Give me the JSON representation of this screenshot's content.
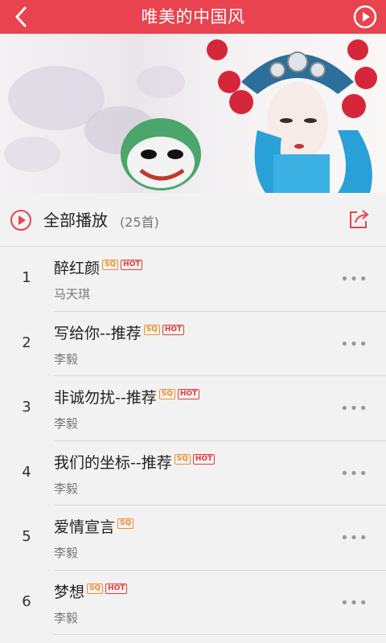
{
  "header": {
    "title": "唯美的中国风"
  },
  "banner": {
    "image": "chinese-opera-woman-with-mask"
  },
  "play_all": {
    "label": "全部播放",
    "count": "(25首)"
  },
  "badges": {
    "sq": "SQ",
    "hot": "HOT"
  },
  "songs": [
    {
      "num": "1",
      "title": "醉红颜",
      "artist": "马天琪",
      "sq": true,
      "hot": true
    },
    {
      "num": "2",
      "title": "写给你--推荐",
      "artist": "李毅",
      "sq": true,
      "hot": true
    },
    {
      "num": "3",
      "title": "非诚勿扰--推荐",
      "artist": "李毅",
      "sq": true,
      "hot": true
    },
    {
      "num": "4",
      "title": "我们的坐标--推荐",
      "artist": "李毅",
      "sq": true,
      "hot": true
    },
    {
      "num": "5",
      "title": "爱情宣言",
      "artist": "李毅",
      "sq": true,
      "hot": false
    },
    {
      "num": "6",
      "title": "梦想",
      "artist": "李毅",
      "sq": true,
      "hot": true
    }
  ],
  "colors": {
    "accent": "#e8434e",
    "sq": "#f08d2b",
    "hot": "#e43b3b"
  }
}
